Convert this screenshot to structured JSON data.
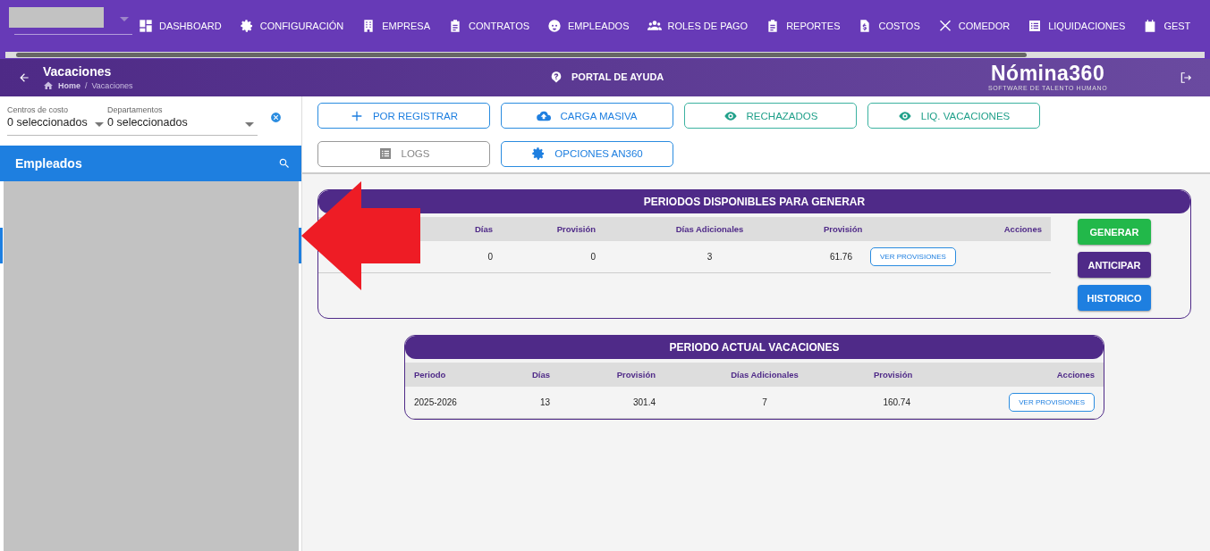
{
  "nav": {
    "items": [
      {
        "label": "DASHBOARD"
      },
      {
        "label": "CONFIGURACIÓN"
      },
      {
        "label": "EMPRESA"
      },
      {
        "label": "CONTRATOS"
      },
      {
        "label": "EMPLEADOS"
      },
      {
        "label": "ROLES DE PAGO"
      },
      {
        "label": "REPORTES"
      },
      {
        "label": "COSTOS"
      },
      {
        "label": "COMEDOR"
      },
      {
        "label": "LIQUIDACIONES"
      },
      {
        "label": "GEST"
      }
    ]
  },
  "header": {
    "title": "Vacaciones",
    "breadcrumb": [
      "Home",
      "Vacaciones"
    ],
    "breadcrumb_separator": "/",
    "help": "PORTAL DE AYUDA",
    "logo": "Nómina360",
    "logo_tagline": "SOFTWARE DE TALENTO HUMANO"
  },
  "filters": [
    {
      "label": "Centros de costo",
      "value": "0 seleccionados"
    },
    {
      "label": "Departamentos",
      "value": "0 seleccionados"
    }
  ],
  "sidebar": {
    "title": "Empleados"
  },
  "actions": [
    {
      "label": "POR REGISTRAR",
      "kind": "blue"
    },
    {
      "label": "CARGA MASIVA",
      "kind": "blue"
    },
    {
      "label": "RECHAZADOS",
      "kind": "teal"
    },
    {
      "label": "LIQ. VACACIONES",
      "kind": "teal"
    },
    {
      "label": "LOGS",
      "kind": "grey"
    },
    {
      "label": "OPCIONES AN360",
      "kind": "blue"
    }
  ],
  "available": {
    "title": "PERIODOS DISPONIBLES PARA GENERAR",
    "columns": [
      "",
      "Días",
      "Provisión",
      "Días Adicionales",
      "Provisión",
      "Acciones"
    ],
    "rows": [
      {
        "cells": [
          "",
          "0",
          "0",
          "3",
          "61.76"
        ],
        "action": "VER PROVISIONES"
      }
    ],
    "buttons": [
      {
        "label": "GENERAR",
        "kind": "green"
      },
      {
        "label": "ANTICIPAR",
        "kind": "purple"
      },
      {
        "label": "HISTORICO",
        "kind": "blue"
      }
    ]
  },
  "current": {
    "title": "PERIODO ACTUAL VACACIONES",
    "columns": [
      "Periodo",
      "Días",
      "Provisión",
      "Días Adicionales",
      "Provisión",
      "Acciones"
    ],
    "rows": [
      {
        "cells": [
          "2025-2026",
          "13",
          "301.4",
          "7",
          "160.74"
        ],
        "action": "VER PROVISIONES"
      }
    ]
  }
}
